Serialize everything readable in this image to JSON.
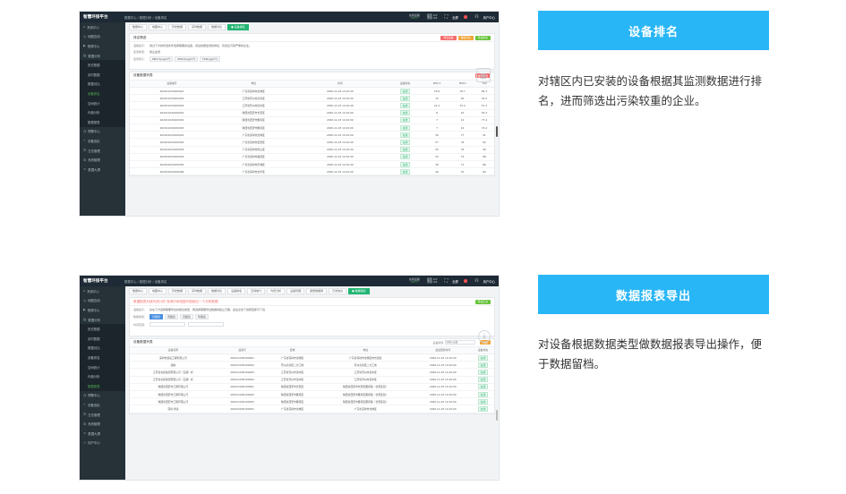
{
  "sections": [
    {
      "title": "设备排名",
      "description": "对辖区内已安装的设备根据其监测数据进行排名，进而筛选出污染较重的企业。"
    },
    {
      "title": "数据报表导出",
      "description": "对设备根据数据类型做数据报表导出操作，便于数据留档。"
    }
  ],
  "app": {
    "logo": "智慧环保平台",
    "breadcrumb": "数据中心 / 数据分析 / 设备排名",
    "stats": [
      {
        "label": "在线设备",
        "value": "100%"
      },
      {
        "label": "报警 0/7",
        "value": "离线 0/1"
      }
    ],
    "fullscreen_icon": "fullscreen-icon",
    "notice_label": "全屏",
    "user": "用户中心"
  },
  "sidebar1": [
    {
      "label": "系统中心",
      "icon": "home-icon"
    },
    {
      "label": "地图应用",
      "icon": "map-icon"
    },
    {
      "label": "视频中心",
      "icon": "video-icon"
    },
    {
      "label": "数据分析",
      "icon": "chart-icon"
    },
    {
      "label": "历史数据",
      "sub": true
    },
    {
      "label": "实时数据",
      "sub": true
    },
    {
      "label": "数据对比",
      "sub": true
    },
    {
      "label": "设备排名",
      "sub": true,
      "active": true
    },
    {
      "label": "空间统计",
      "sub": true
    },
    {
      "label": "均值分析",
      "sub": true
    },
    {
      "label": "数据报表",
      "sub": true
    },
    {
      "label": "预警中心",
      "icon": "bell-icon"
    },
    {
      "label": "设备巡检",
      "icon": "check-icon"
    },
    {
      "label": "日志管理",
      "icon": "log-icon"
    },
    {
      "label": "系统管理",
      "icon": "gear-icon"
    },
    {
      "label": "数据大屏",
      "icon": "screen-icon"
    }
  ],
  "sidebar2": [
    {
      "label": "系统中心",
      "icon": "home-icon"
    },
    {
      "label": "地图应用",
      "icon": "map-icon"
    },
    {
      "label": "视频中心",
      "icon": "video-icon"
    },
    {
      "label": "数据分析",
      "icon": "chart-icon"
    },
    {
      "label": "历史数据",
      "sub": true
    },
    {
      "label": "实时数据",
      "sub": true
    },
    {
      "label": "数据对比",
      "sub": true
    },
    {
      "label": "设备排名",
      "sub": true
    },
    {
      "label": "空间统计",
      "sub": true
    },
    {
      "label": "均值分析",
      "sub": true
    },
    {
      "label": "数据报表",
      "sub": true,
      "active": true
    },
    {
      "label": "预警中心",
      "icon": "bell-icon"
    },
    {
      "label": "设备巡检",
      "icon": "check-icon"
    },
    {
      "label": "日志管理",
      "icon": "log-icon"
    },
    {
      "label": "系统管理",
      "icon": "gear-icon"
    },
    {
      "label": "数据大屏",
      "icon": "screen-icon"
    },
    {
      "label": "用户中心",
      "icon": "user-icon"
    }
  ],
  "tabs1": [
    {
      "label": "数据中心"
    },
    {
      "label": "地图中心"
    },
    {
      "label": "历史数据"
    },
    {
      "label": "实时数据"
    },
    {
      "label": "数据对比"
    },
    {
      "label": "● 设备排名",
      "active": true
    }
  ],
  "tabs2": [
    {
      "label": "数据中心"
    },
    {
      "label": "地图中心"
    },
    {
      "label": "历史数据"
    },
    {
      "label": "实时数据"
    },
    {
      "label": "数据对比"
    },
    {
      "label": "设备排名"
    },
    {
      "label": "空间统计"
    },
    {
      "label": "均值分析"
    },
    {
      "label": "设备管理"
    },
    {
      "label": "报警数据库"
    },
    {
      "label": "日志信息"
    },
    {
      "label": "● 数据报表",
      "active": true
    }
  ],
  "panel1": {
    "filter_title": "排名筛选",
    "buttons": [
      "导出设备",
      "数据对比",
      "导出排名"
    ],
    "tip_label": "温馨提示：",
    "tip": "通过下方的筛选条件选择需要的设备，然后依据监测的排名，筛选出污染严重的企业。",
    "type_label": "监测类型：",
    "type_value": "扬尘监测",
    "metric_label": "监测因子：",
    "metrics": [
      "PM2.5(ug/m³)",
      "PM10(ug/m³)",
      "TSP(ug/m³)"
    ],
    "list_title": "设备数据列表",
    "list_button": "排序方式",
    "columns": [
      "设备编号",
      "地址",
      "时间",
      "设备状态",
      "PM2.5",
      "PM10",
      "TSP"
    ],
    "rows": [
      [
        "202011030100001",
        "广东省深圳市龙岗区",
        "2020-11-03 14:10:00",
        "在线",
        "23.8",
        "78.7",
        "84.3"
      ],
      [
        "202011030100002",
        "江苏省苏州市高新区",
        "2020-11-03 14:10:00",
        "在线",
        "15",
        "40",
        "52.5"
      ],
      [
        "202011030100003",
        "江苏省苏州市吴中区",
        "2020-11-03 14:10:00",
        "在线",
        "21.4",
        "33.4",
        "57.3"
      ],
      [
        "202011040100001",
        "陕西省西安市长安区",
        "2020-11-03 14:10:00",
        "在线",
        "8",
        "10",
        "54.3"
      ],
      [
        "202011040100002",
        "陕西省西安市雁塔区",
        "2020-11-03 14:10:00",
        "在线",
        "7",
        "12",
        "77.4"
      ],
      [
        "202011040100003",
        "陕西省西安市雁塔区",
        "2020-11-03 14:10:00",
        "在线",
        "7",
        "14",
        "74.4"
      ],
      [
        "202012020100001",
        "广东省深圳市龙岗区",
        "2020-11-03 14:10:00",
        "在线",
        "59",
        "77",
        "91"
      ],
      [
        "202012020100002",
        "广东省深圳市宝安区",
        "2020-11-03 14:10:00",
        "在线",
        "57",
        "79",
        "92"
      ],
      [
        "202012020100003",
        "广东省深圳市南山区",
        "2020-11-03 14:10:00",
        "在线",
        "55",
        "76",
        "90"
      ],
      [
        "202012020100004",
        "广东省深圳市福田区",
        "2020-11-03 14:10:00",
        "在线",
        "52",
        "74",
        "88"
      ],
      [
        "202012020100005",
        "广东省深圳市罗湖区",
        "2020-11-03 14:10:00",
        "在线",
        "49",
        "71",
        "86"
      ],
      [
        "202012020100006",
        "广东省深圳市龙华区",
        "2020-11-03 14:10:00",
        "在线",
        "46",
        "70",
        "84"
      ]
    ]
  },
  "panel2": {
    "notice": "数据报表为按天统计的 查询时间范围不能超过一个月的数据",
    "export_button": "导出汇总",
    "tip_label": "温馨提示：",
    "tip": "先在下方选择需要导出的报表类型，再选择需要导出数据的起止日期，最后点击下载按钮即可下载",
    "type_label": "数据类型：",
    "types": [
      "日报表",
      "周报表",
      "月报表",
      "年报表"
    ],
    "time_label": "时间范围：",
    "list_title": "设备数据列表",
    "search_label": "设备搜索",
    "search_placeholder": "请输入设备",
    "search_button": "搜索",
    "columns": [
      "设备名称",
      "设备号",
      "区域",
      "地址",
      "最后更新时间",
      "设备状态"
    ],
    "rows": [
      [
        "深圳市建设工程有限公司",
        "202011030100001",
        "广东省深圳市龙岗区",
        "广东省深圳市龙岗区布吉街道",
        "2020-11-03 14:10:00",
        "在线"
      ],
      [
        "建模",
        "202011030100002",
        "苏州高新区二分工地",
        "苏州高新区二分工地",
        "2020-11-03 14:10:00",
        "在线"
      ],
      [
        "江苏省交建集团有限公司（五期）标",
        "202011030100003",
        "江苏省苏州市吴中区",
        "江苏省苏州市吴中区",
        "2020-11-03 14:10:00",
        "在线"
      ],
      [
        "江苏省交建集团有限公司（五期）标",
        "202011030100004",
        "江苏省苏州市吴中区",
        "江苏省苏州市吴中区",
        "2020-11-03 14:10:00",
        "在线"
      ],
      [
        "陕西省西安市工程有限公司",
        "202011040100001",
        "陕西省西安市长安区",
        "陕西省西安市长安区雁塔路（长安区段）",
        "2020-11-03 14:10:00",
        "在线"
      ],
      [
        "陕西省西安市工程有限公司",
        "202011040100002",
        "陕西省西安市雁塔区",
        "陕西省西安市雁塔区雁塔路（长安区段）",
        "2020-11-03 14:10:00",
        "在线"
      ],
      [
        "陕西省西安市工程有限公司",
        "202011040100003",
        "陕西省西安市雁塔区",
        "陕西省西安市雁塔区雁塔路（长安区段）",
        "2020-11-03 14:10:00",
        "在线"
      ],
      [
        "深圳 测试",
        "202012020100001",
        "广东省深圳市龙岗区",
        "广东省深圳市龙岗区",
        "2020-11-03 14:10:00",
        "在线"
      ]
    ]
  }
}
